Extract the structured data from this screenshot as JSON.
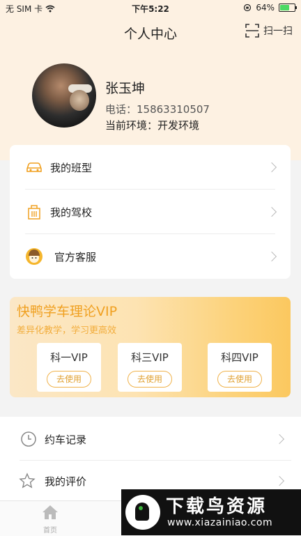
{
  "status_bar": {
    "carrier": "无 SIM 卡",
    "time": "下午5:22",
    "battery": "64%",
    "battery_level": 0.64
  },
  "nav": {
    "title": "个人中心",
    "scan_label": "扫一扫"
  },
  "profile": {
    "name": "张玉坤",
    "phone": "电话：15863310507",
    "environment": "当前环境：开发环境"
  },
  "menu1": [
    {
      "label": "我的班型",
      "icon": "car-icon"
    },
    {
      "label": "我的驾校",
      "icon": "building-icon"
    },
    {
      "label": "官方客服",
      "icon": "customer-service-icon"
    }
  ],
  "vip": {
    "title": "快鸭学车理论VIP",
    "subtitle": "差异化教学，学习更高效",
    "cards": [
      {
        "name": "科一VIP",
        "button": "去使用"
      },
      {
        "name": "科三VIP",
        "button": "去使用"
      },
      {
        "name": "科四VIP",
        "button": "去使用"
      }
    ]
  },
  "menu2": [
    {
      "label": "约车记录",
      "icon": "clock-icon"
    },
    {
      "label": "我的评价",
      "icon": "star-icon"
    }
  ],
  "tabbar": {
    "home_label": "首页"
  },
  "watermark": {
    "title": "下载鸟资源",
    "url": "www.xiazainiao.com"
  },
  "colors": {
    "accent": "#f0a020",
    "header_bg": "#fdf1e2",
    "battery_fill": "#4cd964"
  }
}
